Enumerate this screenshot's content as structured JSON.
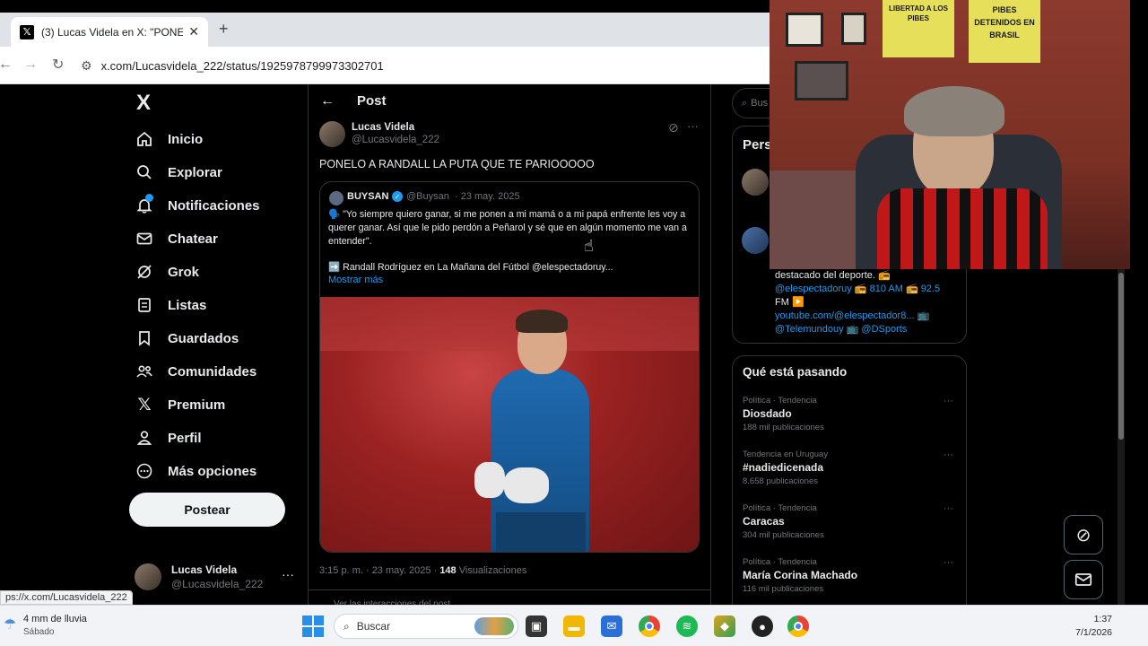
{
  "browser": {
    "tab_title": "(3) Lucas Videla en X: \"PONELO",
    "url": "x.com/Lucasvidela_222/status/1925978799973302701",
    "status_url": "ps://x.com/Lucasvidela_222"
  },
  "nav": {
    "logo": "X",
    "items": [
      {
        "label": "Inicio",
        "icon": "home-icon"
      },
      {
        "label": "Explorar",
        "icon": "search-icon"
      },
      {
        "label": "Notificaciones",
        "icon": "bell-icon"
      },
      {
        "label": "Chatear",
        "icon": "mail-icon"
      },
      {
        "label": "Grok",
        "icon": "grok-icon"
      },
      {
        "label": "Listas",
        "icon": "list-icon"
      },
      {
        "label": "Guardados",
        "icon": "bookmark-icon"
      },
      {
        "label": "Comunidades",
        "icon": "people-icon"
      },
      {
        "label": "Premium",
        "icon": "x-icon"
      },
      {
        "label": "Perfil",
        "icon": "person-icon"
      },
      {
        "label": "Más opciones",
        "icon": "more-icon"
      }
    ],
    "post_button": "Postear",
    "account": {
      "name": "Lucas Videla",
      "handle": "@Lucasvidela_222"
    }
  },
  "post": {
    "header": "Post",
    "author_name": "Lucas Videla",
    "author_handle": "@Lucasvidela_222",
    "text": "PONELO A RANDALL LA PUTA QUE TE PARIOOOOO",
    "quote": {
      "name": "BUYSAN",
      "handle": "@Buysan",
      "date": "· 23 may. 2025",
      "text": "🗣️ \"Yo siempre quiero ganar, si me ponen a mi mamá o a mi papá enfrente les voy a querer ganar. Así que le pido perdón a Peñarol y sé que en algún momento me van a entender\".",
      "sub": "➡️ Randall Rodríguez en La Mañana del Fútbol @elespectadoruy...",
      "more": "Mostrar más"
    },
    "meta_time": "3:15 p. m. · 23 may. 2025 ·",
    "meta_views_num": "148",
    "meta_views_label": "Visualizaciones",
    "interactions": "Ver las interacciones del post"
  },
  "right": {
    "search_placeholder": "Bus",
    "persons_title": "Pers",
    "bio_lines": [
      "destacado del deporte. 📻",
      "@elespectadoruy 📻 810 AM 📻 92.5",
      "FM ▶️",
      "youtube.com/@elespectador8... 📺",
      "@Telemundouy 📺 @DSports"
    ],
    "trending_title": "Qué está pasando",
    "trends": [
      {
        "context": "Política · Tendencia",
        "name": "Diosdado",
        "count": "188 mil publicaciones"
      },
      {
        "context": "Tendencia en Uruguay",
        "name": "#nadiedicenada",
        "count": "8.658 publicaciones"
      },
      {
        "context": "Política · Tendencia",
        "name": "Caracas",
        "count": "304 mil publicaciones"
      },
      {
        "context": "Política · Tendencia",
        "name": "María Corina Machado",
        "count": "116 mil publicaciones"
      }
    ]
  },
  "webcam": {
    "poster1": "LIBERTAD A LOS PIBES",
    "poster2": "PIBES DETENIDOS EN BRASIL"
  },
  "taskbar": {
    "weather": "4 mm de lluvia",
    "weather_day": "Sábado",
    "search": "Buscar",
    "time": "1:37",
    "date": "7/1/2026"
  }
}
